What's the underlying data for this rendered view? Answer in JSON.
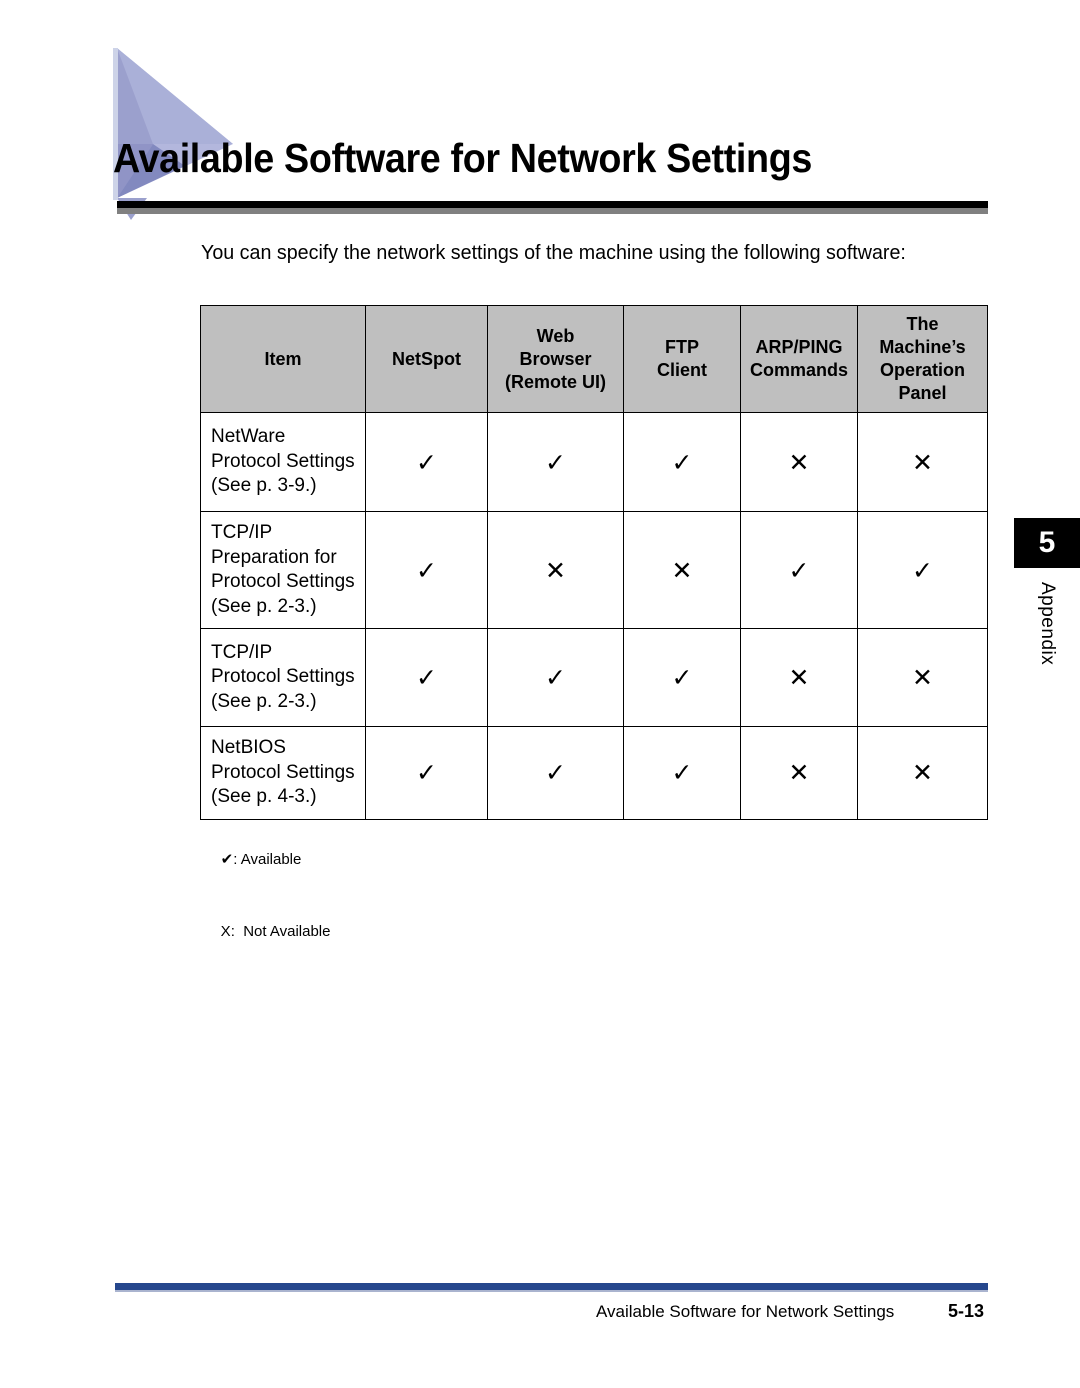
{
  "page": {
    "title": "Available Software for Network Settings",
    "intro": "You can specify the network settings of the machine using the following software:"
  },
  "side_tab": {
    "number": "5",
    "label": "Appendix"
  },
  "table": {
    "headers": [
      "Item",
      "NetSpot",
      "Web\nBrowser\n(Remote UI)",
      "FTP\nClient",
      "ARP/PING\nCommands",
      "The\nMachine’s\nOperation\nPanel"
    ],
    "headers_lines": {
      "item": "Item",
      "netspot": "NetSpot",
      "web_1": "Web",
      "web_2": "Browser",
      "web_3": "(Remote UI)",
      "ftp_1": "FTP",
      "ftp_2": "Client",
      "arp_1": "ARP/PING",
      "arp_2": "Commands",
      "panel_1": "The",
      "panel_2": "Machine’s",
      "panel_3": "Operation",
      "panel_4": "Panel"
    },
    "rows": [
      {
        "item_1": "NetWare",
        "item_2": "Protocol Settings",
        "item_3": "(See p. 3-9.)",
        "netspot": "✓",
        "web": "✓",
        "ftp": "✓",
        "arp": "✕",
        "panel": "✕"
      },
      {
        "item_1": "TCP/IP",
        "item_2": "Preparation for",
        "item_3": "Protocol Settings",
        "item_4": "(See p. 2-3.)",
        "netspot": "✓",
        "web": "✕",
        "ftp": "✕",
        "arp": "✓",
        "panel": "✓"
      },
      {
        "item_1": "TCP/IP",
        "item_2": "Protocol Settings",
        "item_3": "(See p. 2-3.)",
        "netspot": "✓",
        "web": "✓",
        "ftp": "✓",
        "arp": "✕",
        "panel": "✕"
      },
      {
        "item_1": "NetBIOS",
        "item_2": "Protocol Settings",
        "item_3": "(See p. 4-3.)",
        "netspot": "✓",
        "web": "✓",
        "ftp": "✓",
        "arp": "✕",
        "panel": "✕"
      }
    ]
  },
  "legend": {
    "check_glyph": "✔",
    "check_text": ": Available",
    "x_glyph": "X",
    "x_text": ":  Not Available"
  },
  "footer": {
    "title": "Available Software for Network Settings",
    "page_number": "5-13"
  },
  "colors": {
    "header_fill": "#bfbfbf",
    "triangle_light": "#b3b7dd",
    "triangle_mid": "#9ba0cd",
    "triangle_dark": "#8289bf",
    "footer_rule": "#26478d",
    "title_rule_black": "#000000",
    "title_rule_gray": "#808080"
  }
}
